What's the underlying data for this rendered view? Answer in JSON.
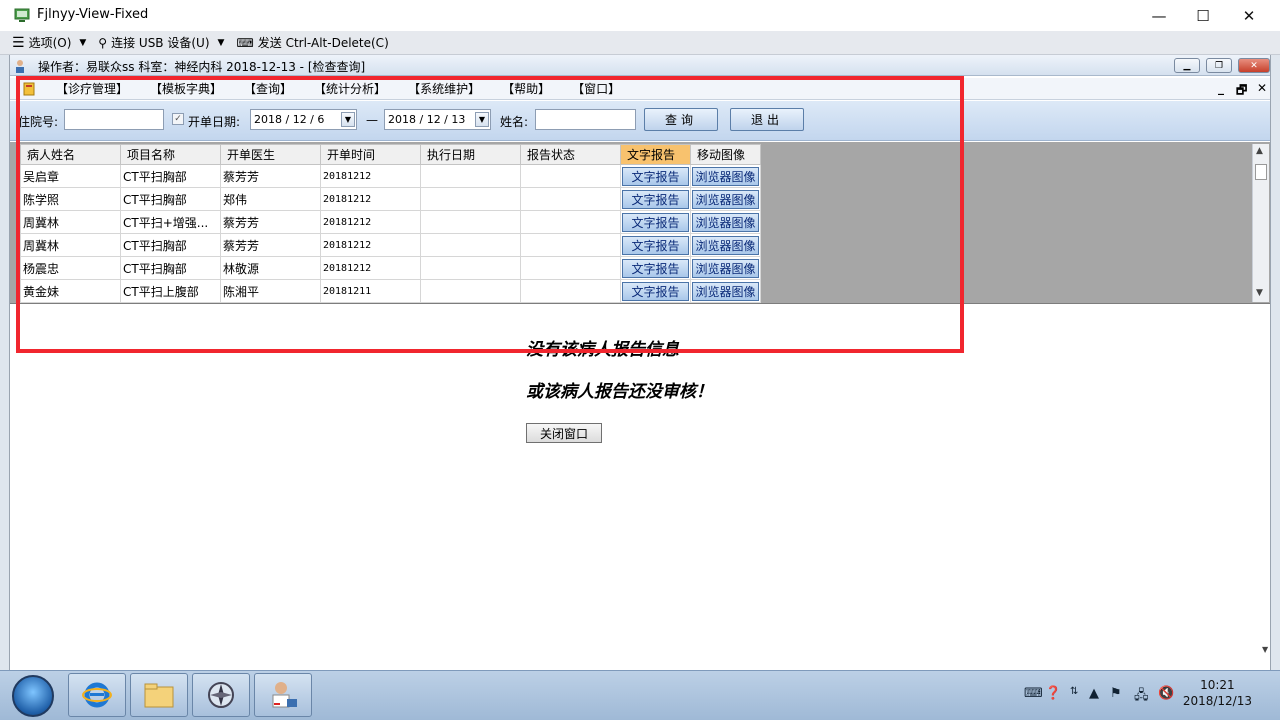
{
  "window": {
    "title": "Fjlnyy-View-Fixed",
    "minimize": "—",
    "maximize": "☐",
    "close": "✕"
  },
  "viewer_toolbar": {
    "options": "选项(O)",
    "usb": "连接 USB 设备(U)",
    "send": "发送 Ctrl-Alt-Delete(C)"
  },
  "app": {
    "title": "操作者：易联众ss   科室：神经内科   2018-12-13 - [检查查询]",
    "menu": [
      "【诊疗管理】",
      "【模板字典】",
      "【查询】",
      "【统计分析】",
      "【系统维护】",
      "【帮助】",
      "【窗口】"
    ]
  },
  "filter": {
    "hospital_no_label": "住院号:",
    "hospital_no_value": "",
    "date_checked": true,
    "date_label": "开单日期:",
    "date_from": "2018 / 12 / 6",
    "date_sep": "—",
    "date_to": "2018 / 12 / 13",
    "name_label": "姓名:",
    "name_value": "",
    "query_button": "查询",
    "exit_button": "退出"
  },
  "grid": {
    "columns": [
      "病人姓名",
      "项目名称",
      "开单医生",
      "开单时间",
      "执行日期",
      "报告状态",
      "文字报告",
      "移动图像"
    ],
    "rows": [
      {
        "name": "吴启章",
        "item": "CT平扫胸部",
        "doctor": "蔡芳芳",
        "time": "20181212",
        "exec": "",
        "status": "",
        "report": "文字报告",
        "image": "浏览器图像"
      },
      {
        "name": "陈学照",
        "item": "CT平扫胸部",
        "doctor": "郑伟",
        "time": "20181212",
        "exec": "",
        "status": "",
        "report": "文字报告",
        "image": "浏览器图像"
      },
      {
        "name": "周冀林",
        "item": "CT平扫+增强...",
        "doctor": "蔡芳芳",
        "time": "20181212",
        "exec": "",
        "status": "",
        "report": "文字报告",
        "image": "浏览器图像"
      },
      {
        "name": "周冀林",
        "item": "CT平扫胸部",
        "doctor": "蔡芳芳",
        "time": "20181212",
        "exec": "",
        "status": "",
        "report": "文字报告",
        "image": "浏览器图像"
      },
      {
        "name": "杨震忠",
        "item": "CT平扫胸部",
        "doctor": "林敬源",
        "time": "20181212",
        "exec": "",
        "status": "",
        "report": "文字报告",
        "image": "浏览器图像"
      },
      {
        "name": "黄金妹",
        "item": "CT平扫上腹部",
        "doctor": "陈湘平",
        "time": "20181211",
        "exec": "",
        "status": "",
        "report": "文字报告",
        "image": "浏览器图像"
      }
    ]
  },
  "content": {
    "message_line1": "没有该病人报告信息",
    "message_line2": "或该病人报告还没审核！",
    "close_button": "关闭窗口"
  },
  "taskbar": {
    "time": "10:21",
    "date": "2018/12/13"
  },
  "colors": {
    "highlight_box": "#f1262e",
    "grid_background": "#a6a6a6",
    "header_highlight": "#f8c26e"
  }
}
